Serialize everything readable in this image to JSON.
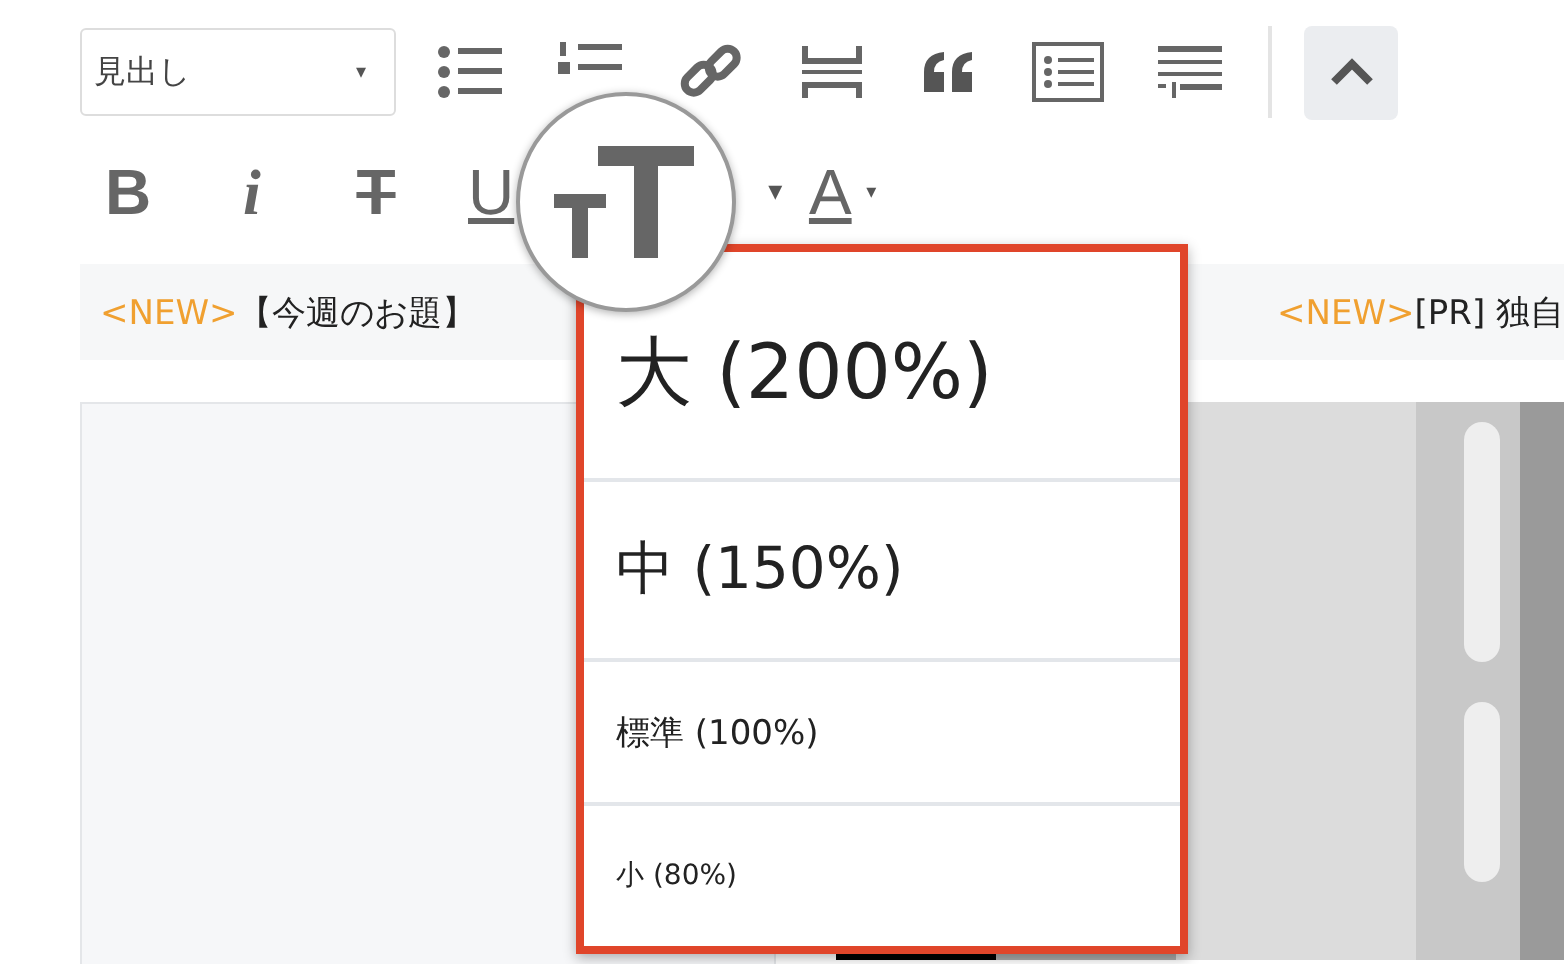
{
  "toolbar": {
    "format_select": {
      "value": "見出し",
      "caret": "▾"
    },
    "row2": [
      {
        "kind": "bold",
        "label": "B"
      },
      {
        "kind": "italic",
        "label": "i"
      },
      {
        "kind": "strike",
        "label": "T"
      },
      {
        "kind": "underline",
        "label": "U"
      }
    ],
    "color_button": {
      "label": "A",
      "caret": "▾"
    },
    "size_caret": "▾",
    "collapse_active": true
  },
  "ticker": [
    {
      "tag": "<NEW>",
      "text": "【今週のお題】"
    },
    {
      "tag": "<NEW>",
      "text": "[PR] 独自"
    }
  ],
  "size_menu": [
    {
      "label": "大 (200%)",
      "kind": "xl"
    },
    {
      "label": "中 (150%)",
      "kind": "lg"
    },
    {
      "label": "標準 (100%)",
      "kind": "md"
    },
    {
      "label": "小 (80%)",
      "kind": "sm"
    }
  ]
}
